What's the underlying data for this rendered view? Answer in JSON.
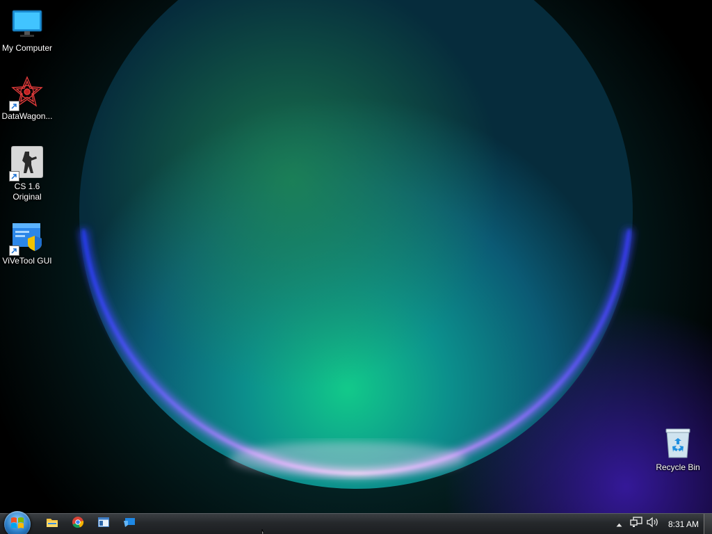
{
  "desktop": {
    "icons": [
      {
        "label": "My Computer",
        "icon": "monitor-icon"
      },
      {
        "label": "DataWagon...",
        "icon": "datawagon-icon"
      },
      {
        "label": "CS 1.6\nOriginal",
        "icon": "counter-strike-icon"
      },
      {
        "label": "ViVeTool GUI",
        "icon": "vivetool-icon"
      },
      {
        "label": "Recycle Bin",
        "icon": "recycle-bin-icon"
      }
    ]
  },
  "taskbar": {
    "pinned": [
      {
        "icon": "file-explorer-icon"
      },
      {
        "icon": "chrome-icon"
      },
      {
        "icon": "window-app-icon"
      },
      {
        "icon": "remote-desktop-icon"
      }
    ],
    "tray": {
      "clock": "8:31 AM",
      "icons": [
        "show-hidden-icons-arrow",
        "network-icon",
        "volume-icon"
      ]
    }
  },
  "colors": {
    "taskbar_bg": "#25282b",
    "wallpaper_glow": "#1fd39a",
    "wallpaper_rim": "#6a3cff"
  }
}
